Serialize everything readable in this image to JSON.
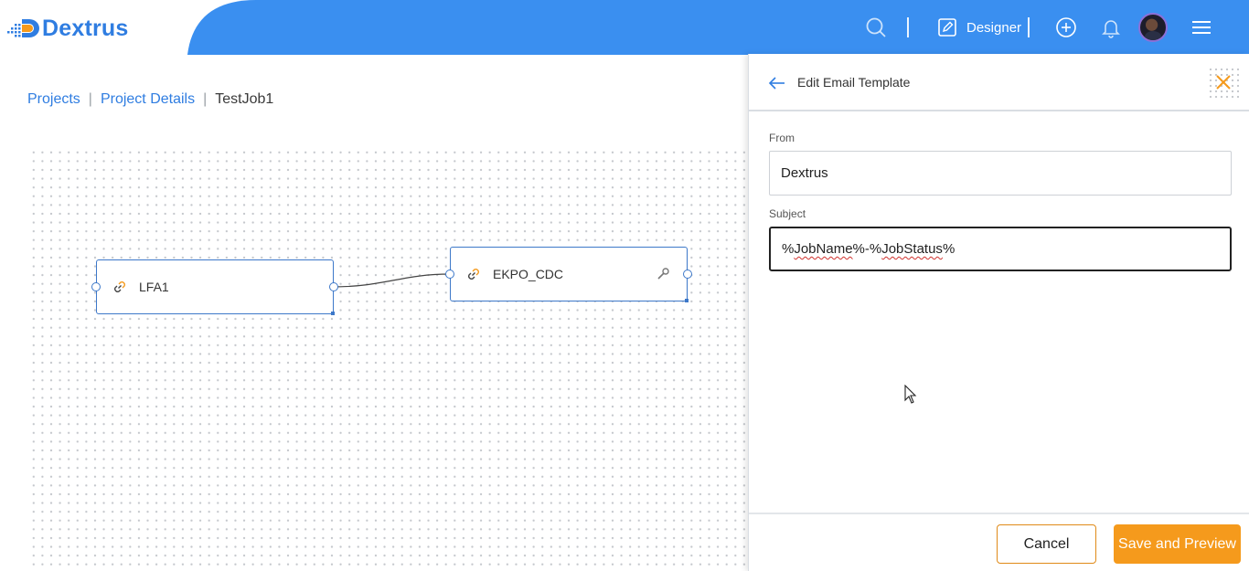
{
  "app": {
    "brand": "Dextrus",
    "brand_color": "#2f7de1",
    "accent_color": "#f59a1c"
  },
  "header": {
    "search_icon": "search-icon",
    "designer_label": "Designer",
    "icons": [
      "search-icon",
      "edit-icon",
      "add-circle-icon",
      "bell-icon",
      "avatar",
      "hamburger-menu-icon"
    ]
  },
  "breadcrumb": {
    "items": [
      {
        "label": "Projects",
        "link": true
      },
      {
        "label": "Project Details",
        "link": true
      },
      {
        "label": "TestJob1",
        "link": false
      }
    ]
  },
  "canvas": {
    "nodes": [
      {
        "label": "LFA1",
        "icon": "link-icon"
      },
      {
        "label": "EKPO_CDC",
        "icon": "link-icon",
        "settings_icon": "wrench-icon"
      }
    ]
  },
  "panel": {
    "title": "Edit Email Template",
    "back_icon": "back-arrow-icon",
    "close_icon": "close-icon",
    "from": {
      "label": "From",
      "value": "Dextrus"
    },
    "subject": {
      "label": "Subject",
      "parts": [
        "%",
        "JobName",
        "%-%",
        "JobStatus",
        "%"
      ]
    },
    "buttons": {
      "cancel": "Cancel",
      "save_preview": "Save and Preview"
    }
  }
}
